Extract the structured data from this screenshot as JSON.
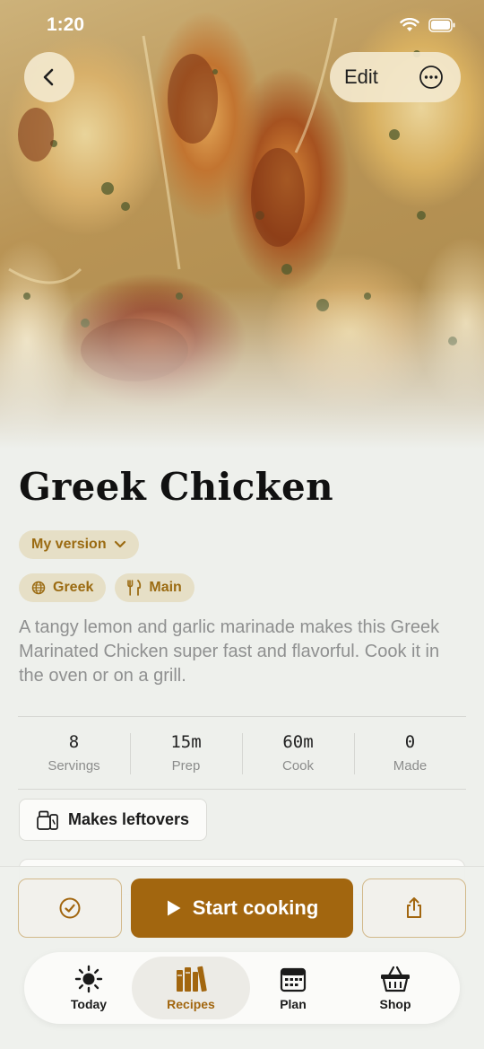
{
  "status_bar": {
    "time": "1:20"
  },
  "top_bar": {
    "edit_label": "Edit"
  },
  "recipe": {
    "title": "Greek Chicken",
    "version_label": "My version",
    "tags": [
      {
        "label": "Greek",
        "icon": "globe-icon"
      },
      {
        "label": "Main",
        "icon": "fork-knife-icon"
      }
    ],
    "description": "A tangy lemon and garlic marinade makes this Greek Marinated Chicken super fast and flavorful. Cook it in the oven or on a grill.",
    "stats": [
      {
        "value": "8",
        "label": "Servings"
      },
      {
        "value": "15m",
        "label": "Prep"
      },
      {
        "value": "60m",
        "label": "Cook"
      },
      {
        "value": "0",
        "label": "Made"
      }
    ],
    "leftovers_label": "Makes leftovers"
  },
  "actions": {
    "start_label": "Start cooking"
  },
  "tab_bar": {
    "tabs": [
      {
        "label": "Today",
        "icon": "sun-icon"
      },
      {
        "label": "Recipes",
        "icon": "books-icon",
        "active": true
      },
      {
        "label": "Plan",
        "icon": "calendar-icon"
      },
      {
        "label": "Shop",
        "icon": "basket-icon"
      }
    ]
  },
  "colors": {
    "accent": "#a2660f",
    "accent_soft": "#e6dfc6",
    "background": "#eef0ec"
  }
}
